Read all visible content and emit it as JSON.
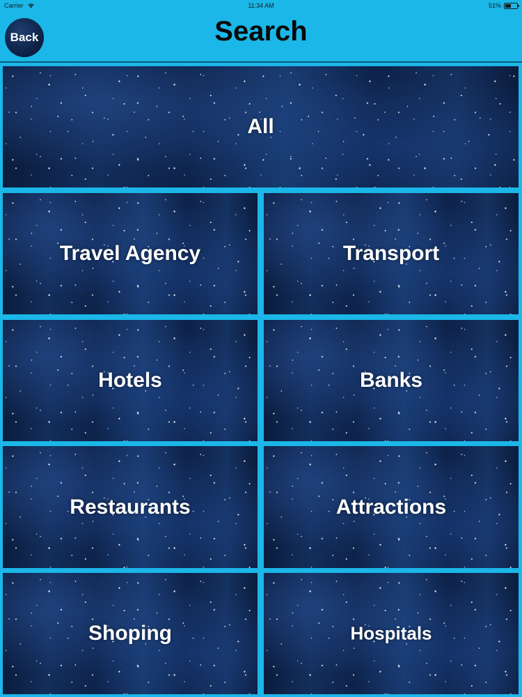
{
  "status_bar": {
    "carrier": "Carrier",
    "time": "11:34 AM",
    "battery": "51%",
    "battery_level": 0.51,
    "wifi_icon": "wifi-icon",
    "battery_icon": "battery-icon"
  },
  "header": {
    "title": "Search",
    "back_label": "Back"
  },
  "colors": {
    "nav_background": "#1bb7e8",
    "tile_background": "#0c1f43",
    "label_text": "#ffffff"
  },
  "categories": [
    {
      "label": "All"
    },
    {
      "label": "Travel Agency"
    },
    {
      "label": "Transport"
    },
    {
      "label": "Hotels"
    },
    {
      "label": "Banks"
    },
    {
      "label": "Restaurants"
    },
    {
      "label": "Attractions"
    },
    {
      "label": "Shoping"
    },
    {
      "label": "Hospitals"
    }
  ]
}
